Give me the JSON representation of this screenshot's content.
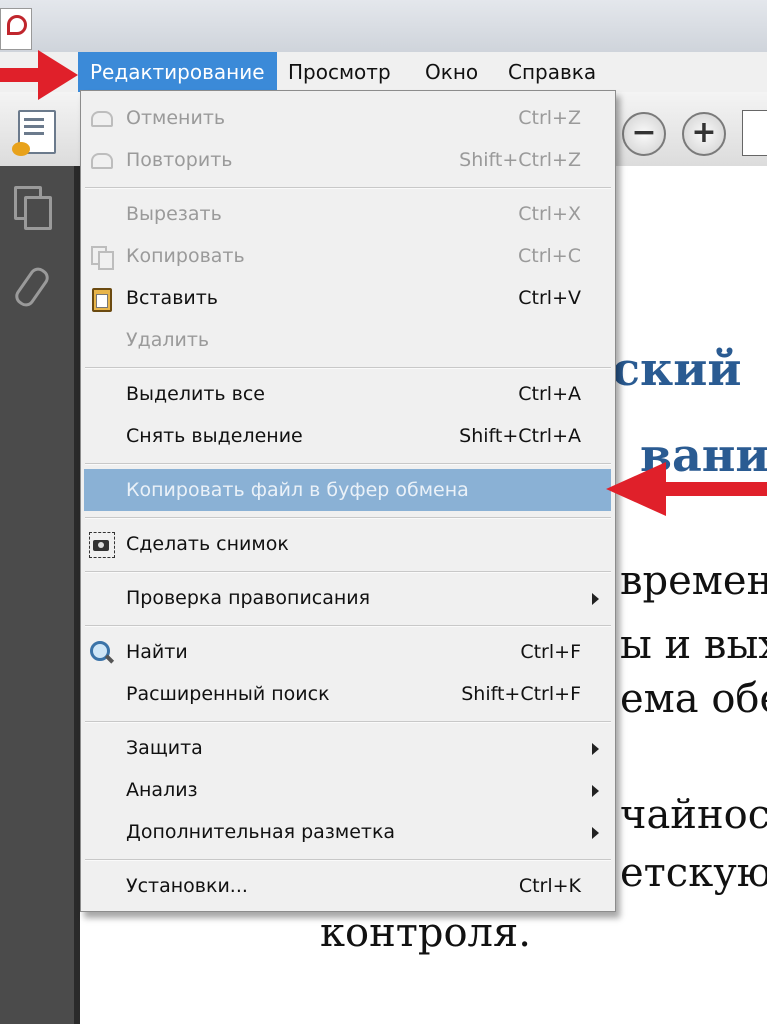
{
  "menubar": {
    "items": [
      {
        "label": "Редактирование",
        "active": true
      },
      {
        "label": "Просмотр"
      },
      {
        "label": "Окно"
      },
      {
        "label": "Справка"
      }
    ]
  },
  "toolbar": {
    "zoom_out_symbol": "−",
    "zoom_in_symbol": "+"
  },
  "edit_menu": {
    "items": [
      {
        "label": "Отменить",
        "shortcut": "Ctrl+Z",
        "icon": "undo-icon",
        "enabled": false
      },
      {
        "label": "Повторить",
        "shortcut": "Shift+Ctrl+Z",
        "icon": "redo-icon",
        "enabled": false
      },
      {
        "label": "Вырезать",
        "shortcut": "Ctrl+X",
        "enabled": false
      },
      {
        "label": "Копировать",
        "shortcut": "Ctrl+C",
        "icon": "copy-icon",
        "enabled": false
      },
      {
        "label": "Вставить",
        "shortcut": "Ctrl+V",
        "icon": "paste-icon",
        "enabled": true
      },
      {
        "label": "Удалить",
        "shortcut": "",
        "enabled": false
      },
      {
        "label": "Выделить все",
        "shortcut": "Ctrl+A",
        "enabled": true
      },
      {
        "label": "Снять выделение",
        "shortcut": "Shift+Ctrl+A",
        "enabled": true
      },
      {
        "label": "Копировать файл в буфер обмена",
        "shortcut": "",
        "enabled": true,
        "highlighted": true
      },
      {
        "label": "Сделать снимок",
        "shortcut": "",
        "icon": "snapshot-icon",
        "enabled": true
      },
      {
        "label": "Проверка правописания",
        "shortcut": "",
        "submenu": true,
        "enabled": true
      },
      {
        "label": "Найти",
        "shortcut": "Ctrl+F",
        "icon": "search-icon",
        "enabled": true
      },
      {
        "label": "Расширенный поиск",
        "shortcut": "Shift+Ctrl+F",
        "enabled": true
      },
      {
        "label": "Защита",
        "shortcut": "",
        "submenu": true,
        "enabled": true
      },
      {
        "label": "Анализ",
        "shortcut": "",
        "submenu": true,
        "enabled": true
      },
      {
        "label": "Дополнительная разметка",
        "shortcut": "",
        "submenu": true,
        "enabled": true
      },
      {
        "label": "Установки...",
        "shortcut": "Ctrl+K",
        "enabled": true
      }
    ]
  },
  "document": {
    "heading_lines": [
      "ский",
      "вани"
    ],
    "body_lines": [
      "времен",
      "ы и вых",
      "ема обес",
      "чайнос",
      "етскую",
      "контроля."
    ]
  },
  "colors": {
    "menu_highlight": "#3b8ad8",
    "item_highlight": "#8ab1d5",
    "arrow": "#e0202a",
    "heading": "#2a5b92"
  }
}
